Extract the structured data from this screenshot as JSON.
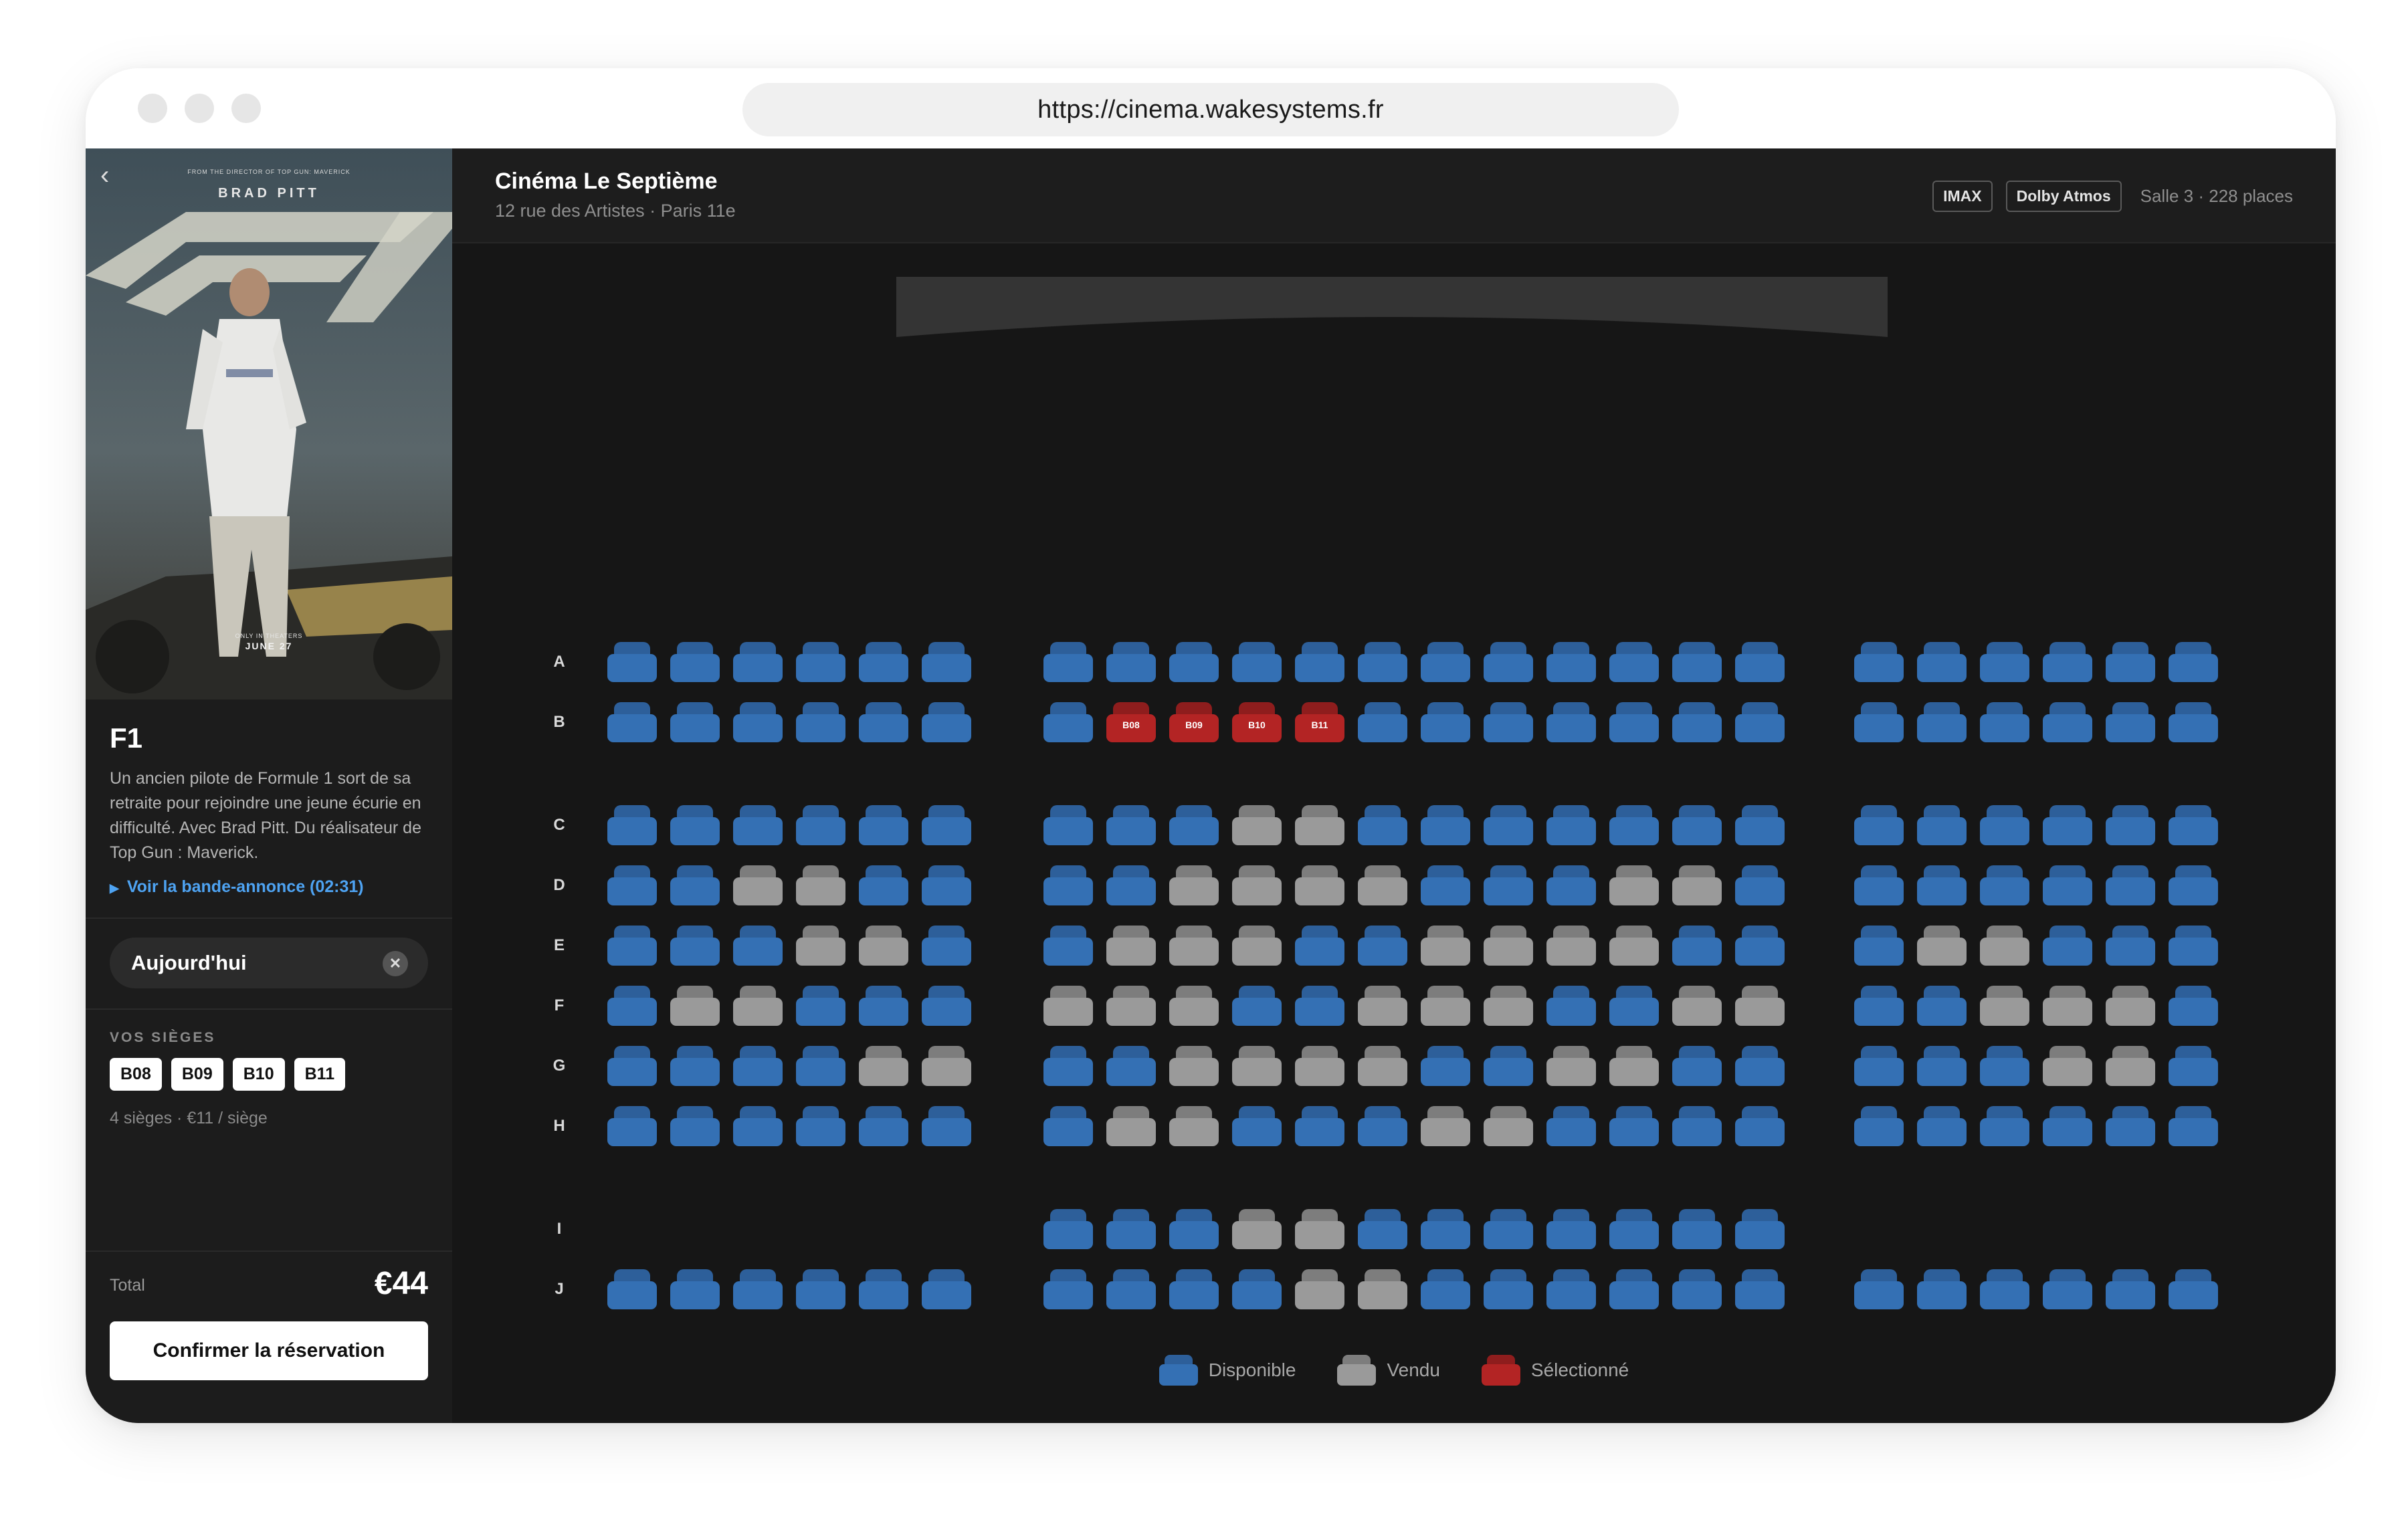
{
  "browser": {
    "url": "https://cinema.wakesystems.fr"
  },
  "sidebar": {
    "poster": {
      "tagline": "FROM THE DIRECTOR OF TOP GUN: MAVERICK",
      "actor": "BRAD PITT",
      "release_line1": "ONLY IN THEATERS",
      "release_line2": "JUNE 27"
    },
    "back_icon": "‹",
    "movie_title": "F1",
    "description": "Un ancien pilote de Formule 1 sort de sa retraite pour rejoindre une jeune écurie en difficulté. Avec Brad Pitt. Du réalisateur de Top Gun : Maverick.",
    "trailer_label": "Voir la bande-annonce (02:31)",
    "date_value": "Aujourd'hui",
    "seats_section_label": "VOS SIÈGES",
    "selected_seats": [
      "B08",
      "B09",
      "B10",
      "B11"
    ],
    "seat_summary": "4 sièges · €11 / siège",
    "total_label": "Total",
    "total_value": "€44",
    "confirm_label": "Confirmer la réservation"
  },
  "header": {
    "cinema_name": "Cinéma Le Septième",
    "address": "12 rue des Artistes · Paris 11e",
    "badges": [
      "IMAX",
      "Dolby Atmos"
    ],
    "room_info": "Salle 3 · 228 places"
  },
  "seatmap": {
    "colors": {
      "available": "#3470b4",
      "sold": "#9a9a9a",
      "selected": "#b32424"
    },
    "rows": [
      {
        "label": "A",
        "left": "AAAAAA",
        "center": "AAAAAAAAAAAA",
        "right": "AAAAAA"
      },
      {
        "label": "B",
        "left": "AAAAAA",
        "center": "ASSSSAAAAAAA",
        "right": "AAAAAA"
      },
      {
        "label": "C",
        "left": "AAAAAA",
        "center": "AAAVVAAAAAAA",
        "right": "AAAAAA"
      },
      {
        "label": "D",
        "left": "AAVVAA",
        "center": "AAVVVVAAAVVA",
        "right": "AAAAAA"
      },
      {
        "label": "E",
        "left": "AAAVVA",
        "center": "AVVVAAVVVVAA",
        "right": "AVVAAA"
      },
      {
        "label": "F",
        "left": "AVVAAA",
        "center": "VVVAAVVVAAVV",
        "right": "AAVVVA"
      },
      {
        "label": "G",
        "left": "AAAAVV",
        "center": "AAVVVVAAVVAA",
        "right": "AAAVVA"
      },
      {
        "label": "H",
        "left": "AAAAAA",
        "center": "AVVAAAVVAAAA",
        "right": "AAAAAA"
      },
      {
        "label": "I",
        "left": "",
        "center": "AAAVVAAAAAAA",
        "right": ""
      },
      {
        "label": "J",
        "left": "AAAAAA",
        "center": "AAAAVVAAAAAA",
        "right": "AAAAAA"
      }
    ]
  },
  "legend": {
    "available": "Disponible",
    "sold": "Vendu",
    "selected": "Sélectionné"
  }
}
